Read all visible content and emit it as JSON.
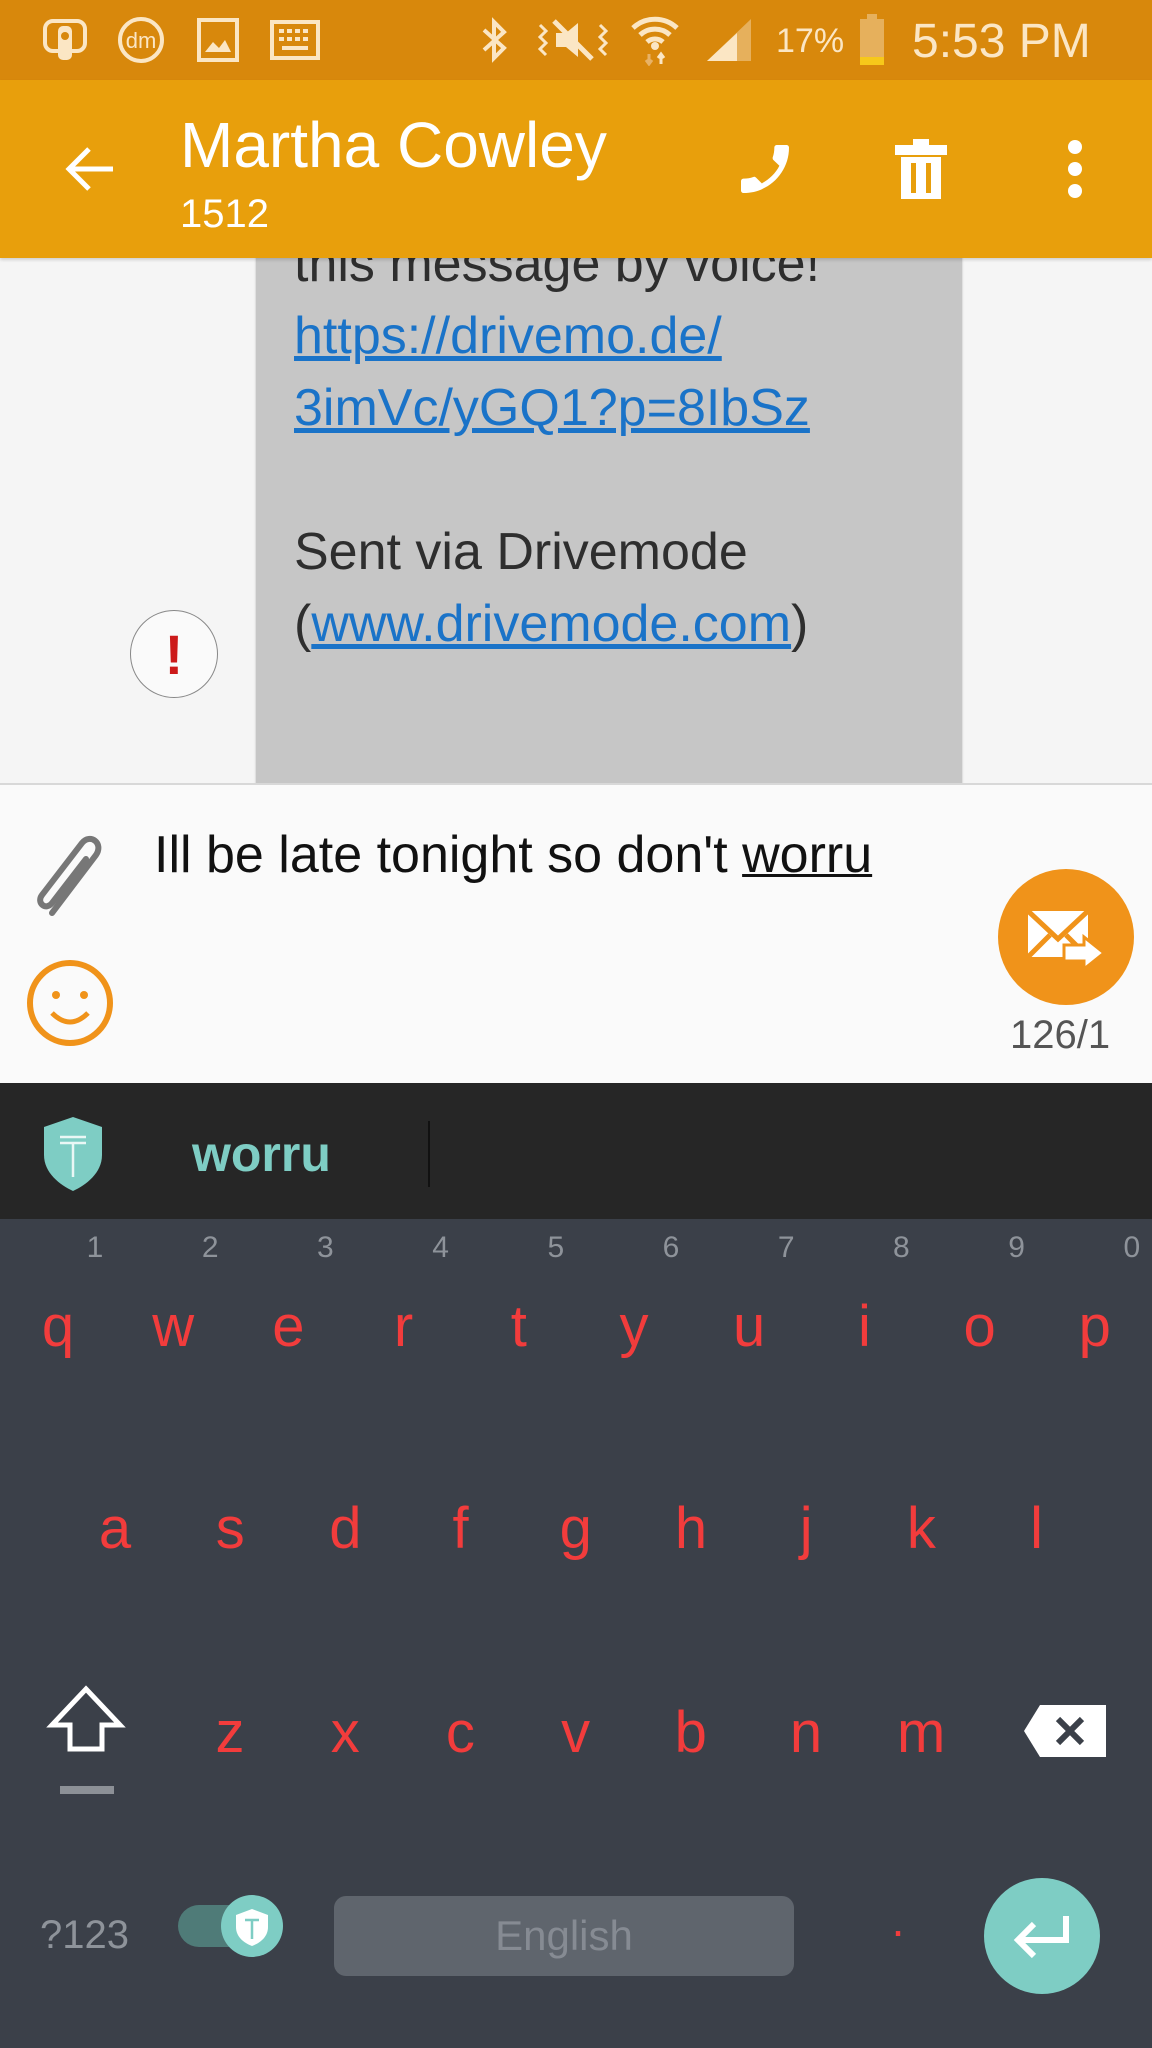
{
  "status_bar": {
    "left_icons": [
      "remote-app-icon",
      "drivemode-icon",
      "image-icon",
      "keyboard-icon"
    ],
    "right_icons": [
      "bluetooth-icon",
      "mute-vibrate-icon",
      "wifi-icon",
      "signal-icon"
    ],
    "battery_percent": "17%",
    "battery_level": 0.17,
    "time": "5:53 PM"
  },
  "app_bar": {
    "contact_name": "Martha Cowley",
    "contact_number": "1512",
    "actions": [
      "call",
      "delete",
      "more"
    ]
  },
  "thread": {
    "message": {
      "partial_line": "this message by voice!",
      "link1_line1": "https://drivemo.de/",
      "link1_line2": "3imVc/yGQ1?p=8IbSz",
      "sent_via": "Sent via Drivemode",
      "paren_open": "(",
      "link2": "www.drivemode.com",
      "paren_close": ")",
      "status": "Failed"
    },
    "error_glyph": "!"
  },
  "composer": {
    "text_before": "Ill be late tonight so don't ",
    "text_underlined": "worru",
    "char_counter": "126/1"
  },
  "keyboard": {
    "suggestion": "worru",
    "numbers": [
      "1",
      "2",
      "3",
      "4",
      "5",
      "6",
      "7",
      "8",
      "9",
      "0"
    ],
    "row1": [
      "q",
      "w",
      "e",
      "r",
      "t",
      "y",
      "u",
      "i",
      "o",
      "p"
    ],
    "row2": [
      "a",
      "s",
      "d",
      "f",
      "g",
      "h",
      "j",
      "k",
      "l"
    ],
    "row3": [
      "z",
      "x",
      "c",
      "v",
      "b",
      "n",
      "m"
    ],
    "symbols_key": "?123",
    "space_label": "English",
    "period_key": ".",
    "accent_color": "#7ecdc4",
    "key_color": "#f23c3c"
  }
}
